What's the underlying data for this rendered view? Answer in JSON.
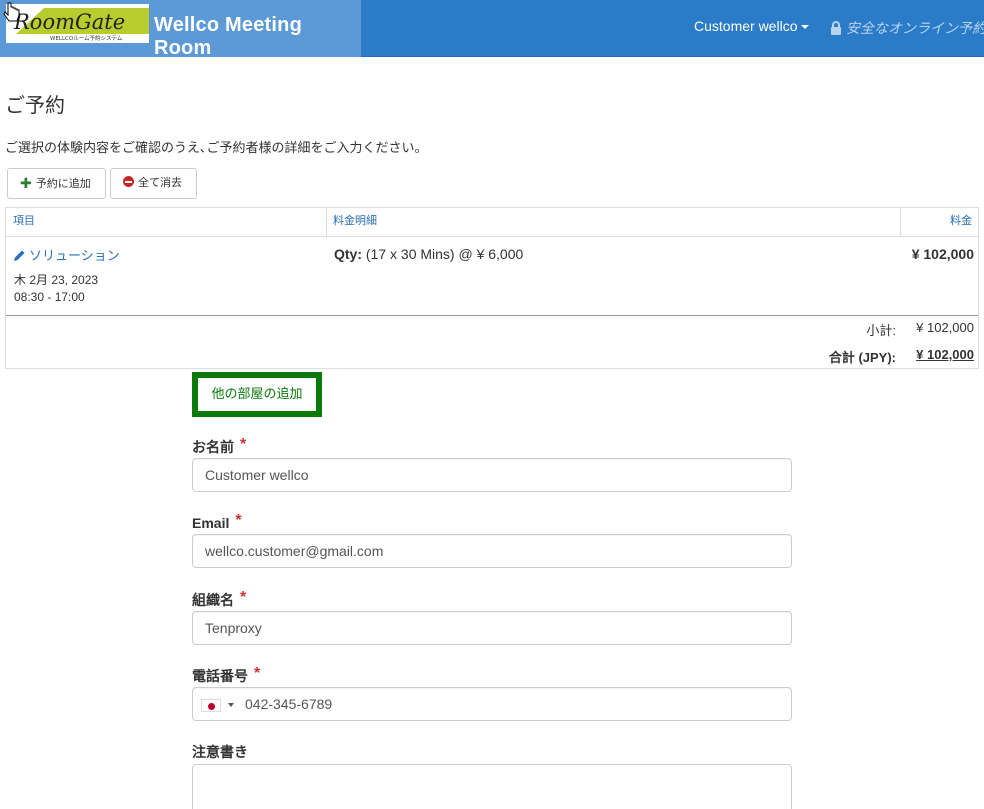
{
  "header": {
    "logo_text": "RoomGate",
    "logo_subtext": "WELLCOルーム予約システム",
    "brand_title": "Wellco Meeting Room",
    "user_menu": "Customer wellco",
    "secure_label": "安全なオンライン予約",
    "colors": {
      "navbar": "#2a7bc8",
      "brand_box": "#5b9ad6"
    }
  },
  "page": {
    "title": "ご予約",
    "intro": "ご選択の体験内容をご確認のうえ､ご予約者様の詳細をご入力ください。"
  },
  "toolbar": {
    "add_label": "予約に追加",
    "clear_label": "全て消去"
  },
  "cart": {
    "columns": {
      "item": "項目",
      "detail": "料金明細",
      "price": "料金"
    },
    "items": [
      {
        "name": "ソリューション",
        "date": "木 2月 23, 2023",
        "time": "08:30 - 17:00",
        "qty_label": "Qty:",
        "qty_detail": "(17 x 30 Mins) @ ¥ 6,000",
        "price": "¥ 102,000"
      }
    ],
    "subtotal_label": "小計:",
    "subtotal_value": "¥ 102,000",
    "total_label": "合計 (JPY):",
    "total_value": "¥ 102,000"
  },
  "add_room_label": "他の部屋の追加",
  "form": {
    "required_mark": "*",
    "name_label": "お名前",
    "name_value": "Customer wellco",
    "email_label": "Email",
    "email_value": "wellco.customer@gmail.com",
    "org_label": "組織名",
    "org_value": "Tenproxy",
    "phone_label": "電話番号",
    "phone_country": "JP",
    "phone_value": "042-345-6789",
    "notes_label": "注意書き",
    "notes_value": ""
  }
}
